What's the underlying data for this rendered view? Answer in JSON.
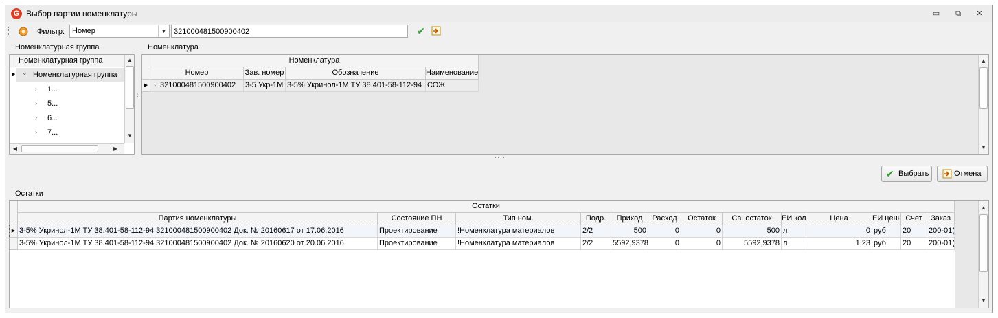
{
  "window": {
    "title": "Выбор партии номенклатуры",
    "buttons": {
      "minimize": "▭",
      "restore": "⧉",
      "close": "✕"
    }
  },
  "toolbar": {
    "filter_label": "Фильтр:",
    "filter_field": "Номер",
    "filter_value": "321000481500900402"
  },
  "group_panel": {
    "title": "Номенклатурная группа",
    "column_header": "Номенклатурная группа",
    "root": "Номенклатурная группа",
    "children": [
      "1...",
      "5...",
      "6...",
      "7..."
    ]
  },
  "nomenclature_panel": {
    "title": "Номенклатура",
    "band_header": "Номенклатура",
    "columns": [
      "Номер",
      "Зав. номер",
      "Обозначение",
      "Наименование"
    ],
    "rows": [
      [
        "321000481500900402",
        "3-5 Укр-1М",
        "3-5% Укринол-1М ТУ 38.401-58-112-94",
        "СОЖ"
      ]
    ]
  },
  "buttons": {
    "select": "Выбрать",
    "cancel": "Отмена"
  },
  "stock_panel": {
    "title": "Остатки",
    "band_header": "Остатки",
    "columns": [
      "Партия номенклатуры",
      "Состояние ПН",
      "Тип ном.",
      "Подр.",
      "Приход",
      "Расход",
      "Остаток",
      "Св. остаток",
      "ЕИ кол",
      "Цена",
      "ЕИ цены",
      "Счет",
      "Заказ"
    ],
    "rows": [
      [
        "3-5% Укринол-1М ТУ 38.401-58-112-94 321000481500900402 Док. № 20160617 от 17.06.2016",
        "Проектирование",
        "!Номенклатура материалов",
        "2/2",
        "500",
        "0",
        "0",
        "500",
        "л",
        "0",
        "руб",
        "20",
        "200-01("
      ],
      [
        "3-5% Укринол-1М ТУ 38.401-58-112-94 321000481500900402 Док. № 20160620 от 20.06.2016",
        "Проектирование",
        "!Номенклатура материалов",
        "2/2",
        "5592,9378",
        "0",
        "0",
        "5592,9378",
        "л",
        "1,23",
        "руб",
        "20",
        "200-01("
      ]
    ]
  },
  "colors": {
    "accent": "#d8402a",
    "ok": "#2e9b2e",
    "window_bg": "#f0f0f0"
  }
}
